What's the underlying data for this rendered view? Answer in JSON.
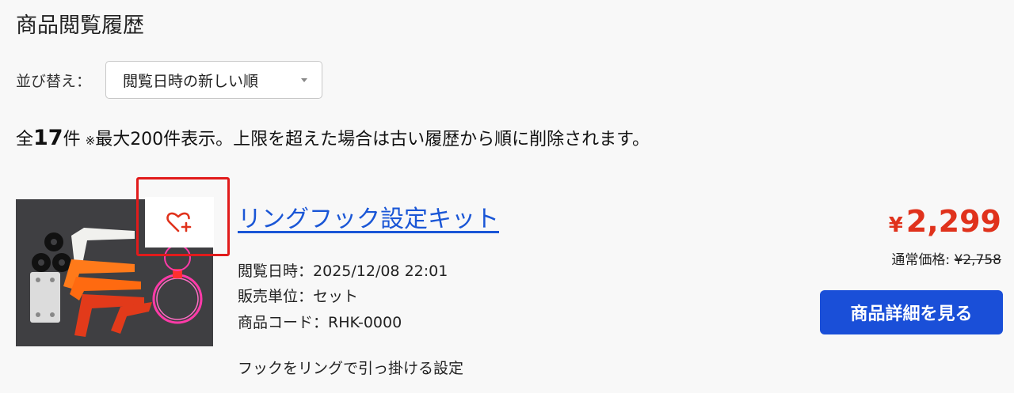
{
  "page": {
    "title": "商品閲覧履歴"
  },
  "sort": {
    "label": "並び替え：",
    "selected": "閲覧日時の新しい順",
    "icon": "chevron-down-icon"
  },
  "summary": {
    "prefix": "全",
    "count": "17",
    "suffix": "件",
    "note_mark": "※",
    "note": "最大200件表示。上限を超えた場合は古い履歴から順に削除されます。"
  },
  "product": {
    "name": "リングフック設定キット",
    "viewed_label": "閲覧日時：",
    "viewed_value": "2025/12/08 22:01",
    "unit_label": "販売単位：",
    "unit_value": "セット",
    "code_label": "商品コード：",
    "code_value": "RHK-0000",
    "description": "フックをリングで引っ掛ける設定",
    "price_symbol": "¥",
    "price": "2,299",
    "regular_label": "通常価格: ",
    "regular_price": "¥2,758",
    "detail_button": "商品詳細を見る",
    "favorite_icon": "heart-plus-icon",
    "colors": {
      "price": "#e0321c",
      "link": "#1a56d6",
      "button": "#1a4fd8",
      "favorite_highlight": "#e11b1b"
    }
  }
}
